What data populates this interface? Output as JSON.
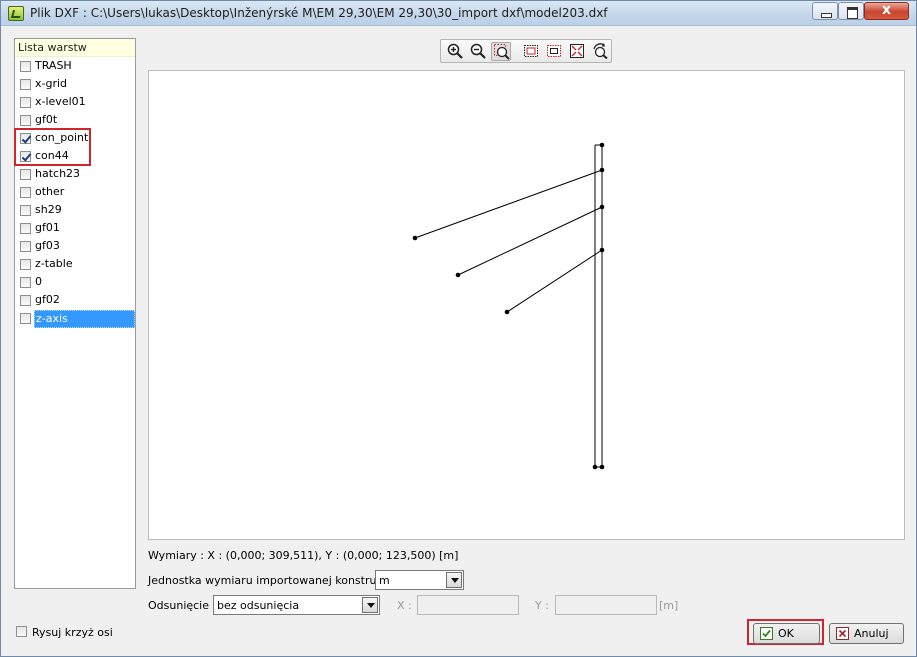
{
  "window": {
    "title": "Plik DXF : C:\\Users\\lukas\\Desktop\\Inženýrské M\\EM 29,30\\EM 29,30\\30_import dxf\\model203.dxf",
    "close_glyph": "x"
  },
  "layers": {
    "header": "Lista warstw",
    "items": [
      {
        "label": "TRASH",
        "checked": false
      },
      {
        "label": "x-grid",
        "checked": false
      },
      {
        "label": "x-level01",
        "checked": false
      },
      {
        "label": "gf0t",
        "checked": false
      },
      {
        "label": "con_point",
        "checked": true
      },
      {
        "label": "con44",
        "checked": true
      },
      {
        "label": "hatch23",
        "checked": false
      },
      {
        "label": "other",
        "checked": false
      },
      {
        "label": "sh29",
        "checked": false
      },
      {
        "label": "gf01",
        "checked": false
      },
      {
        "label": "gf03",
        "checked": false
      },
      {
        "label": "z-table",
        "checked": false
      },
      {
        "label": "0",
        "checked": false
      },
      {
        "label": "gf02",
        "checked": false
      },
      {
        "label": "z-axis",
        "checked": false,
        "selected": true
      }
    ]
  },
  "axis_option": {
    "label": "Rysuj krzyż osi",
    "checked": false
  },
  "toolbar": {
    "tools": [
      "zoom-in-icon",
      "zoom-out-icon",
      "zoom-window-icon",
      "select-window-icon",
      "select-fit-icon",
      "zoom-extents-icon",
      "rotate-view-icon"
    ],
    "active": "zoom-window-icon"
  },
  "dimensions_text": "Wymiary : X : (0,000; 309,511), Y : (0,000; 123,500) [m]",
  "unit": {
    "label": "Jednostka wymiaru importowanej konstrukcji :",
    "value": "m"
  },
  "offset": {
    "label": "Odsunięcie :",
    "value": "bez odsunięcia",
    "x_label": "X :",
    "x_value": "",
    "y_label": "Y :",
    "y_value": "",
    "unit_label": "[m]"
  },
  "buttons": {
    "ok": "OK",
    "cancel": "Anuluj"
  },
  "colors": {
    "selection": "#3399ff",
    "highlight": "#d2242d",
    "header_bg": "#ffffe1"
  }
}
